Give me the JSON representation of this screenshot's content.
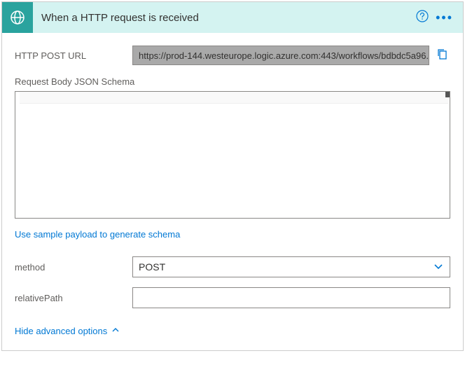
{
  "header": {
    "title": "When a HTTP request is received"
  },
  "url": {
    "label": "HTTP POST URL",
    "value": "https://prod-144.westeurope.logic.azure.com:443/workflows/bdbdc5a96..."
  },
  "schema": {
    "label": "Request Body JSON Schema"
  },
  "sampleLink": {
    "label": "Use sample payload to generate schema"
  },
  "method": {
    "label": "method",
    "value": "POST"
  },
  "relativePath": {
    "label": "relativePath",
    "value": ""
  },
  "advanced": {
    "label": "Hide advanced options"
  }
}
